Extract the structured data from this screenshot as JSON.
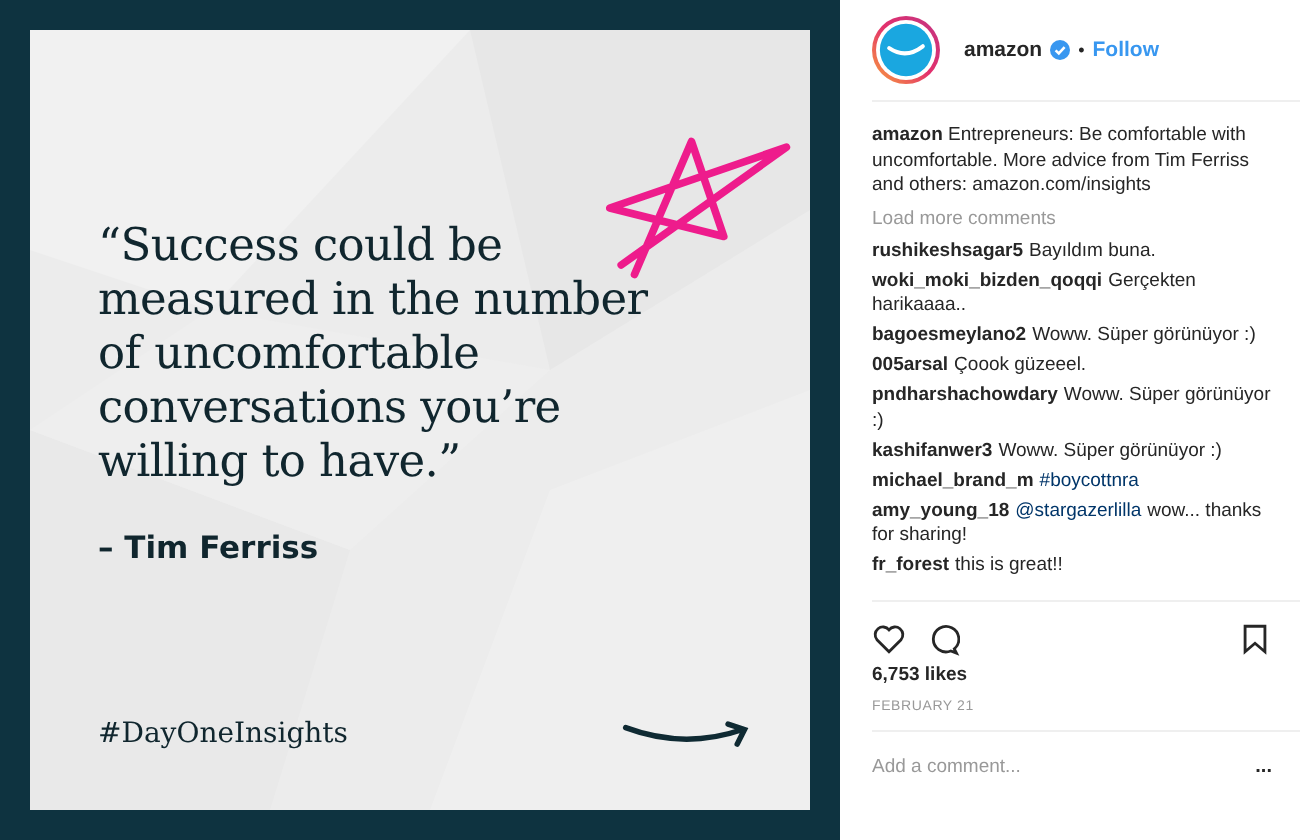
{
  "post_image": {
    "quote_lines": [
      "“Success could be",
      "measured in the number",
      "of uncomfortable",
      "conversations you’re",
      "willing to have.”"
    ],
    "author": "– Tim Ferriss",
    "hashtag": "#DayOneInsights"
  },
  "header": {
    "username": "amazon",
    "verified": true,
    "separator": "•",
    "follow": "Follow"
  },
  "caption": {
    "username": "amazon",
    "text": "Entrepreneurs: Be comfortable with uncomfortable. More advice from Tim Ferriss and others: amazon.com/insights"
  },
  "load_more": "Load more comments",
  "comments": [
    {
      "username": "rushikeshsagar5",
      "parts": [
        {
          "text": "Bayıldım buna.",
          "link": false
        }
      ]
    },
    {
      "username": "woki_moki_bizden_qoqqi",
      "parts": [
        {
          "text": "Gerçekten harikaaaa..",
          "link": false
        }
      ]
    },
    {
      "username": "bagoesmeylano2",
      "parts": [
        {
          "text": "Woww. Süper görünüyor :)",
          "link": false
        }
      ]
    },
    {
      "username": "005arsal",
      "parts": [
        {
          "text": "Çoook güzeeel.",
          "link": false
        }
      ]
    },
    {
      "username": "pndharshachowdary",
      "parts": [
        {
          "text": "Woww. Süper görünüyor :)",
          "link": false
        }
      ]
    },
    {
      "username": "kashifanwer3",
      "parts": [
        {
          "text": "Woww. Süper görünüyor :)",
          "link": false
        }
      ]
    },
    {
      "username": "michael_brand_m",
      "parts": [
        {
          "text": "#boycottnra",
          "link": true
        }
      ]
    },
    {
      "username": "amy_young_18",
      "parts": [
        {
          "text": "@stargazerlilla",
          "link": true
        },
        {
          "text": "wow... thanks for sharing!",
          "link": false
        }
      ]
    },
    {
      "username": "fr_forest",
      "parts": [
        {
          "text": "this is great!!",
          "link": false
        }
      ]
    }
  ],
  "actions": {
    "liked": false,
    "saved": false
  },
  "likes": "6,753 likes",
  "date": "FEBRUARY 21",
  "comment_field": {
    "placeholder": "Add a comment..."
  },
  "more": "..."
}
